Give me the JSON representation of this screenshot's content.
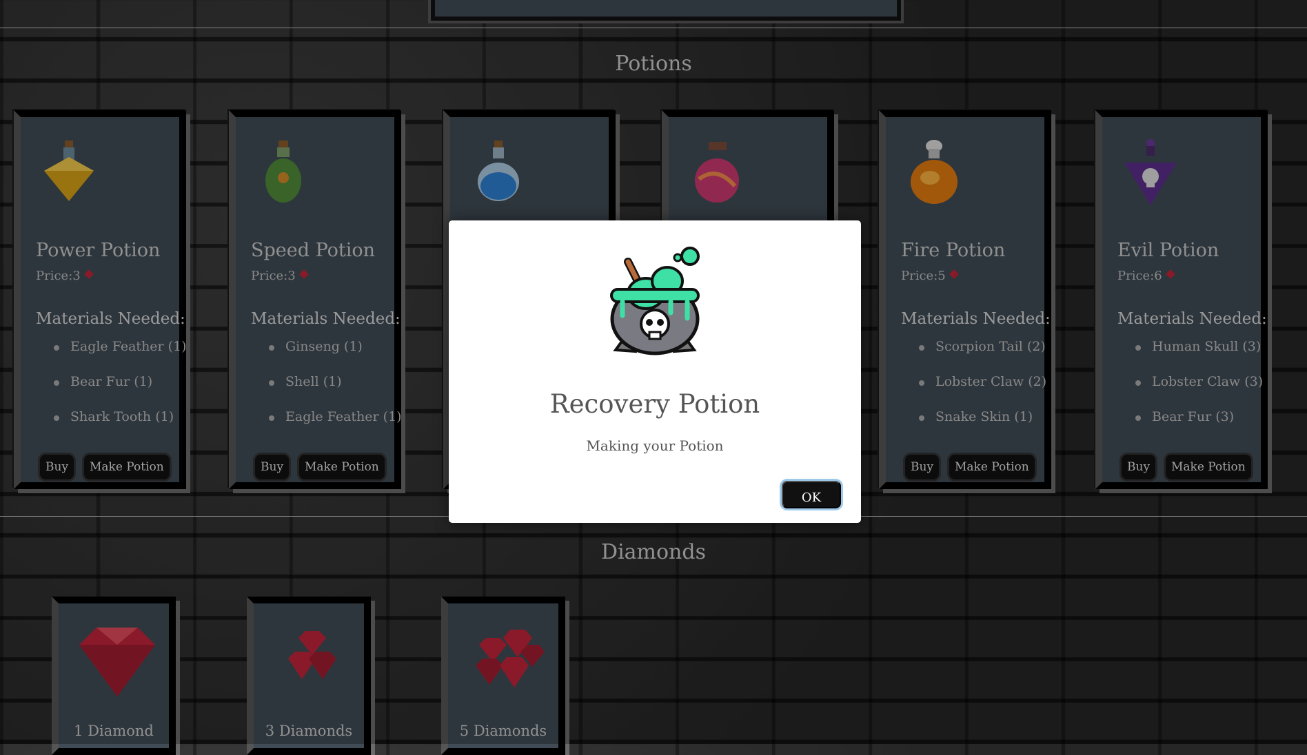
{
  "sections": {
    "potions_title": "Potions",
    "diamonds_title": "Diamonds"
  },
  "potions": [
    {
      "name": "Power Potion",
      "price": "Price:3",
      "materials_title": "Materials Needed:",
      "materials": [
        "Eagle Feather (1)",
        "Bear Fur (1)",
        "Shark Tooth (1)"
      ],
      "buy": "Buy",
      "make": "Make Potion",
      "icon": "power-potion-icon",
      "color": "#d4a017"
    },
    {
      "name": "Speed Potion",
      "price": "Price:3",
      "materials_title": "Materials Needed:",
      "materials": [
        "Ginseng (1)",
        "Shell (1)",
        "Eagle Feather (1)"
      ],
      "buy": "Buy",
      "make": "Make Potion",
      "icon": "speed-potion-icon",
      "color": "#4f8a3a"
    },
    {
      "name": "",
      "price": "",
      "materials_title": "",
      "materials": [],
      "buy": "",
      "make": "",
      "icon": "blue-potion-icon",
      "color": "#2f7fd0"
    },
    {
      "name": "",
      "price": "",
      "materials_title": "",
      "materials": [],
      "buy": "",
      "make": "",
      "icon": "pink-potion-icon",
      "color": "#c8386e"
    },
    {
      "name": "Fire Potion",
      "price": "Price:5",
      "materials_title": "Materials Needed:",
      "materials": [
        "Scorpion Tail (2)",
        "Lobster Claw (2)",
        "Snake Skin (1)"
      ],
      "buy": "Buy",
      "make": "Make Potion",
      "icon": "fire-potion-icon",
      "color": "#e07a10"
    },
    {
      "name": "Evil Potion",
      "price": "Price:6",
      "materials_title": "Materials Needed:",
      "materials": [
        "Human Skull (3)",
        "Lobster Claw (3)",
        "Bear Fur (3)"
      ],
      "buy": "Buy",
      "make": "Make Potion",
      "icon": "evil-potion-icon",
      "color": "#5a2e8a"
    }
  ],
  "diamonds": [
    {
      "label": "1 Diamond",
      "icon": "diamond-icon"
    },
    {
      "label": "3 Diamonds",
      "icon": "diamonds-icon"
    },
    {
      "label": "5 Diamonds",
      "icon": "diamonds-icon"
    }
  ],
  "modal": {
    "title": "Recovery Potion",
    "text": "Making your Potion",
    "ok": "OK",
    "icon": "cauldron-icon"
  },
  "colors": {
    "gem": "#c0243a",
    "card": "#414b55",
    "cauldron_goo": "#3ee0a6"
  }
}
